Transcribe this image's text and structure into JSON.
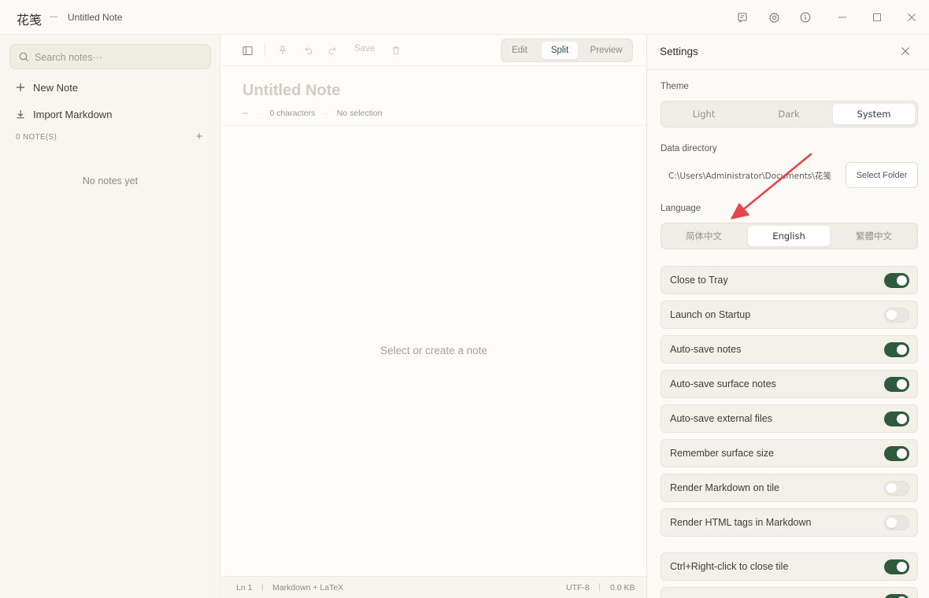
{
  "titlebar": {
    "app_name": "花笺",
    "doc_title": "Untitled Note",
    "icons": [
      "notes-icon",
      "gear-icon",
      "info-icon",
      "minimize-icon",
      "maximize-icon",
      "close-icon"
    ]
  },
  "sidebar": {
    "search_placeholder": "Search notes···",
    "new_note": "New Note",
    "import_markdown": "Import Markdown",
    "notes_count_label": "0 NOTE(S)",
    "empty_text": "No notes yet"
  },
  "editor": {
    "save_label": "Save",
    "modes": [
      "Edit",
      "Split",
      "Preview"
    ],
    "active_mode": "Split",
    "title_placeholder": "Untitled Note",
    "meta": {
      "date": "--",
      "characters": "0 characters",
      "selection": "No selection"
    },
    "empty_text": "Select or create a note",
    "status": {
      "line": "Ln 1",
      "mode": "Markdown + LaTeX",
      "encoding": "UTF-8",
      "size": "0.0 KB"
    }
  },
  "settings": {
    "title": "Settings",
    "theme_label": "Theme",
    "themes": [
      "Light",
      "Dark",
      "System"
    ],
    "active_theme": "System",
    "data_dir_label": "Data directory",
    "data_dir_path": "C:\\Users\\Administrator\\Documents\\花笺",
    "select_folder": "Select Folder",
    "language_label": "Language",
    "languages": [
      "简体中文",
      "English",
      "繁體中文"
    ],
    "active_language": "English",
    "toggles": [
      {
        "label": "Close to Tray",
        "on": true
      },
      {
        "label": "Launch on Startup",
        "on": false
      },
      {
        "label": "Auto-save notes",
        "on": true
      },
      {
        "label": "Auto-save surface notes",
        "on": true
      },
      {
        "label": "Auto-save external files",
        "on": true
      },
      {
        "label": "Remember surface size",
        "on": true
      },
      {
        "label": "Render Markdown on tile",
        "on": false
      },
      {
        "label": "Render HTML tags in Markdown",
        "on": false
      },
      {
        "label": "Ctrl+Right-click to close tile",
        "on": true
      },
      {
        "label": "",
        "on": true
      }
    ]
  },
  "colors": {
    "accent_green": "#2f5a40",
    "annotation_arrow": "#e8454a"
  }
}
